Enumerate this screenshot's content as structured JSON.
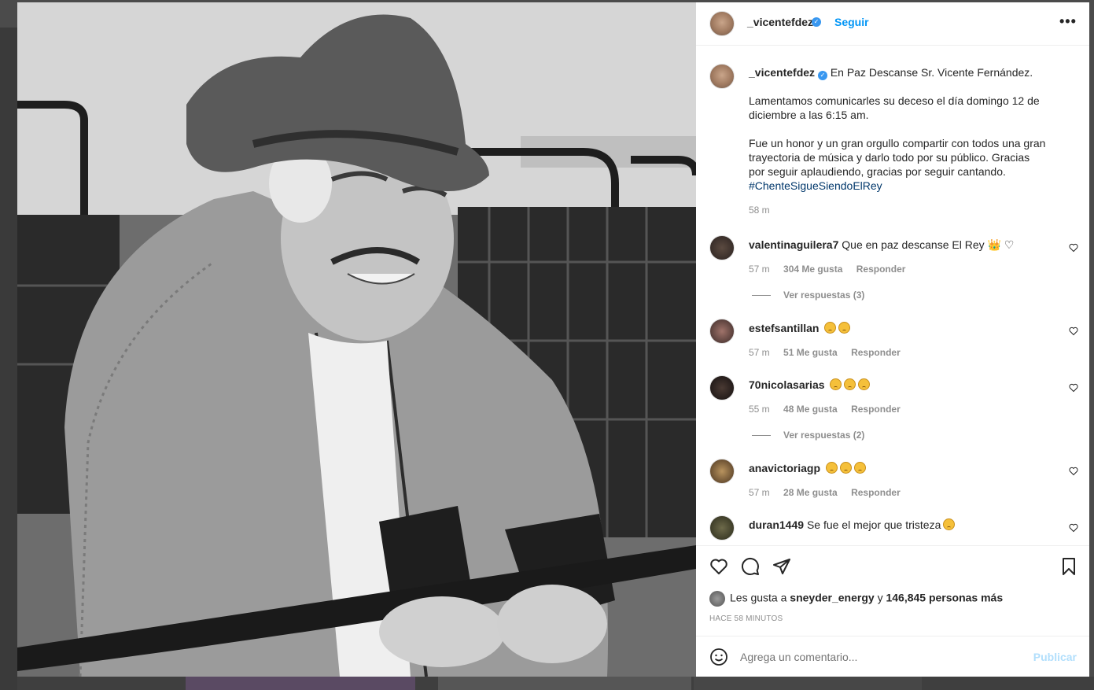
{
  "post": {
    "username": "_vicentefdez",
    "follow_label": "Seguir",
    "more_label": "•••",
    "caption_title": "En Paz Descanse Sr. Vicente Fernández.",
    "caption_p1": "Lamentamos comunicarles su deceso el día domingo 12 de diciembre a las 6:15 am.",
    "caption_p2": "Fue un honor y un gran orgullo compartir con todos una gran trayectoria de música y darlo todo por su público. Gracias por seguir aplaudiendo, gracias por seguir cantando.",
    "hashtag": "#ChenteSigueSiendoElRey",
    "caption_time": "58 m"
  },
  "comments": [
    {
      "user": "valentinaguilera7",
      "text": "Que en paz descanse El Rey 👑 ♡",
      "time": "57 m",
      "likes": "304 Me gusta",
      "reply": "Responder",
      "replies": "Ver respuestas (3)"
    },
    {
      "user": "estefsantillan",
      "text": "",
      "emojis": 2,
      "time": "57 m",
      "likes": "51 Me gusta",
      "reply": "Responder",
      "replies": ""
    },
    {
      "user": "70nicolasarias",
      "text": "",
      "emojis": 3,
      "time": "55 m",
      "likes": "48 Me gusta",
      "reply": "Responder",
      "replies": "Ver respuestas (2)"
    },
    {
      "user": "anavictoriagp",
      "text": "",
      "emojis": 3,
      "time": "57 m",
      "likes": "28 Me gusta",
      "reply": "Responder",
      "replies": ""
    },
    {
      "user": "duran1449",
      "text": "Se fue el mejor que tristeza",
      "emojis": 1,
      "time": "",
      "likes": "",
      "reply": "",
      "replies": ""
    }
  ],
  "likes": {
    "prefix": "Les gusta a ",
    "user": "sneyder_energy",
    "middle": " y ",
    "count": "146,845 personas más"
  },
  "time_caps": "HACE 58 MINUTOS",
  "add_comment": {
    "placeholder": "Agrega un comentario...",
    "publish_label": "Publicar"
  },
  "colors": {
    "accent": "#0095f6",
    "hashtag": "#00376b",
    "muted": "#8e8e8e"
  }
}
